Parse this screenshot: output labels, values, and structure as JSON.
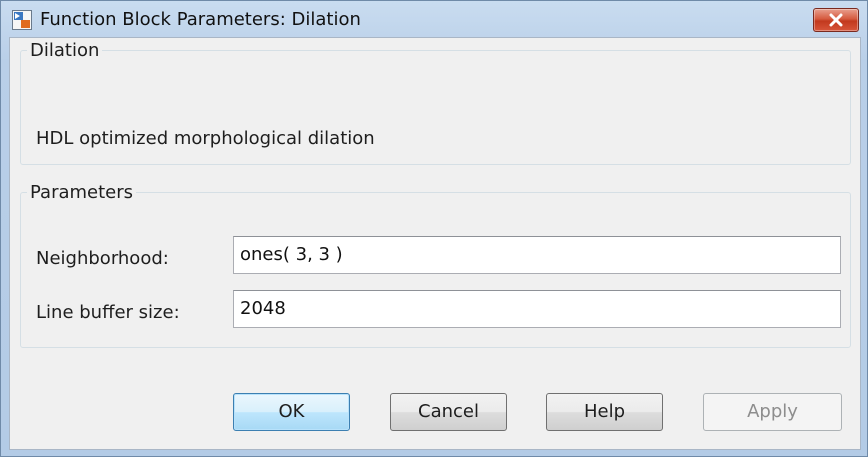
{
  "window": {
    "title": "Function Block Parameters: Dilation"
  },
  "description_group": {
    "legend": "Dilation",
    "text": "HDL optimized morphological dilation"
  },
  "parameters_group": {
    "legend": "Parameters",
    "neighborhood_label": "Neighborhood:",
    "neighborhood_value": "ones( 3, 3 )",
    "line_buffer_label": "Line buffer size:",
    "line_buffer_value": "2048"
  },
  "buttons": {
    "ok": "OK",
    "cancel": "Cancel",
    "help": "Help",
    "apply": "Apply"
  },
  "colors": {
    "titlebar": "#b9cfe8",
    "close_button": "#c7432a",
    "client_background": "#f0f0f0",
    "default_button": "#bee6fd"
  },
  "icons": {
    "app": "simulink-block-icon",
    "close": "close-icon"
  }
}
